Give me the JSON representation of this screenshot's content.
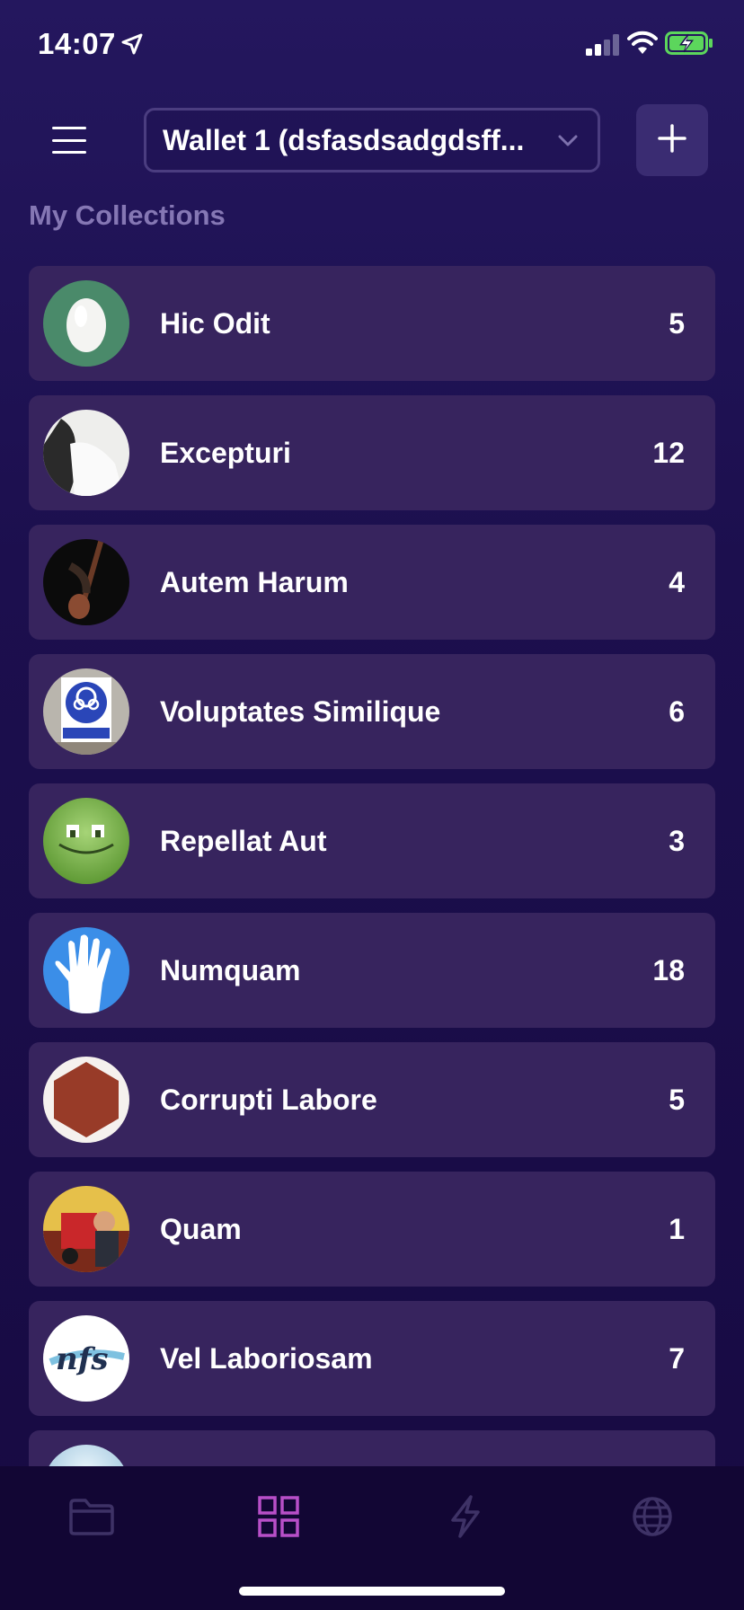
{
  "status_bar": {
    "time": "14:07",
    "icons": [
      "location-arrow-icon",
      "cellular-signal-icon",
      "wifi-icon",
      "battery-charging-icon"
    ],
    "battery_color": "#5cd65c"
  },
  "header": {
    "menu_icon": "hamburger-icon",
    "wallet_label": "Wallet 1 (dsfasdsadgdsff...",
    "add_icon": "plus-icon"
  },
  "section": {
    "title": "My Collections"
  },
  "collections": [
    {
      "name": "Hic Odit",
      "count": "5",
      "avatar": "egg-avatar"
    },
    {
      "name": "Excepturi",
      "count": "12",
      "avatar": "photo-avatar"
    },
    {
      "name": "Autem Harum",
      "count": "4",
      "avatar": "guitar-avatar"
    },
    {
      "name": "Voluptates Similique",
      "count": "6",
      "avatar": "sign-avatar"
    },
    {
      "name": "Repellat Aut",
      "count": "3",
      "avatar": "smiley-avatar"
    },
    {
      "name": "Numquam",
      "count": "18",
      "avatar": "hand-avatar"
    },
    {
      "name": "Corrupti Labore",
      "count": "5",
      "avatar": "hexagon-avatar"
    },
    {
      "name": "Quam",
      "count": "1",
      "avatar": "photo-avatar"
    },
    {
      "name": "Vel Laboriosam",
      "count": "7",
      "avatar": "nfs-logo-avatar"
    }
  ],
  "tabs": [
    {
      "name": "folder-icon",
      "active": false
    },
    {
      "name": "grid-icon",
      "active": true
    },
    {
      "name": "lightning-icon",
      "active": false
    },
    {
      "name": "globe-icon",
      "active": false
    }
  ],
  "colors": {
    "accent": "#b84fc8",
    "row_bg": "#37245e",
    "inactive_icon": "#3e3266"
  }
}
